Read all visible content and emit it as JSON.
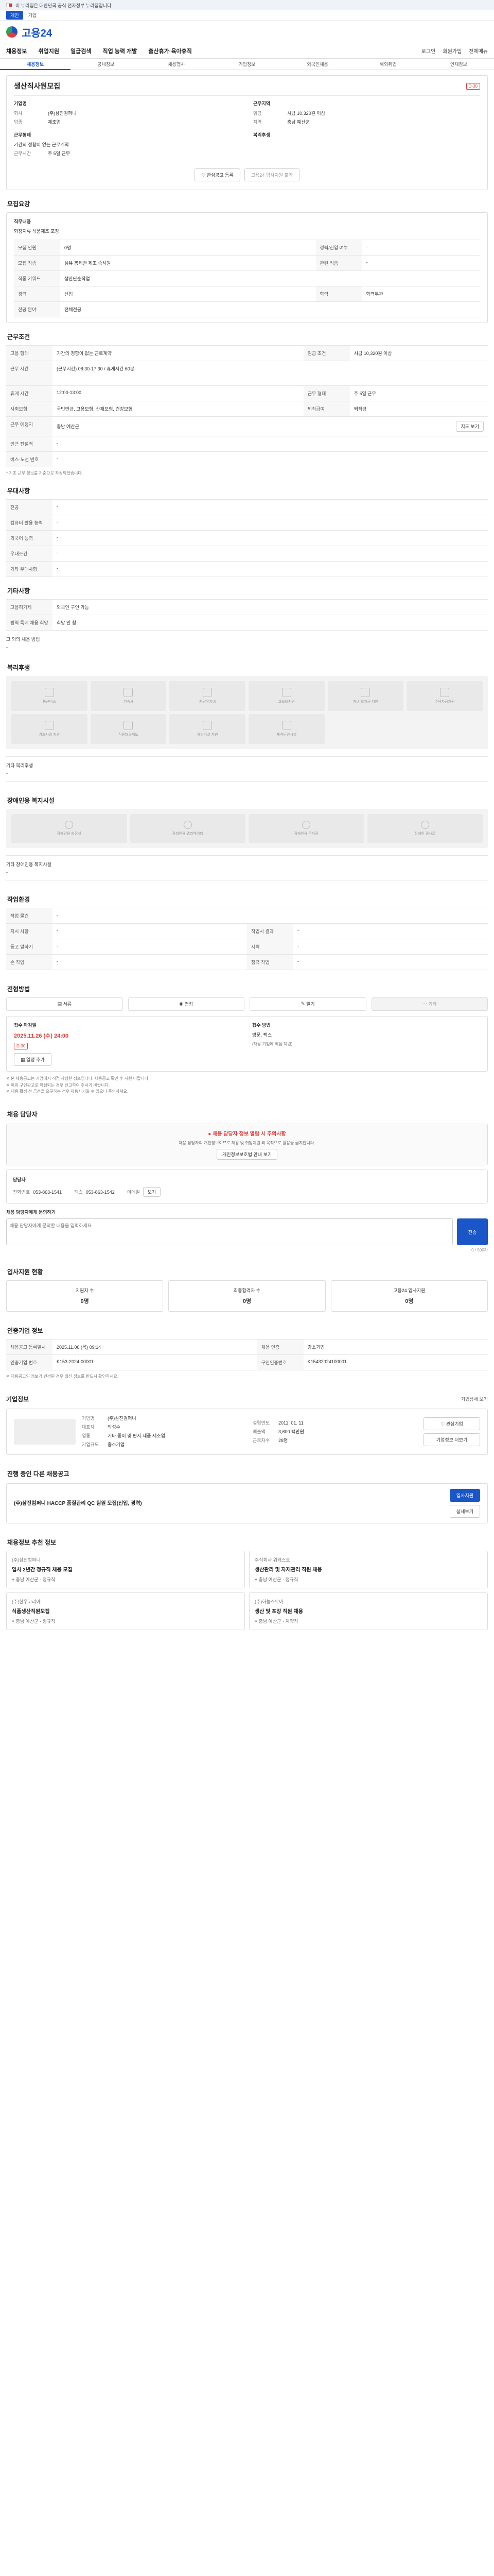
{
  "gov_banner": "이 누리집은 대한민국 공식 전자정부 누리집입니다.",
  "top_util": [
    "개인",
    "기업"
  ],
  "brand": "고용24",
  "gnb": [
    "채용정보",
    "취업지원",
    "일급검색",
    "직업 능력 개발",
    "출산휴가·육아휴직"
  ],
  "gnb_right": [
    "로그인",
    "회원가입",
    "전체메뉴"
  ],
  "subtabs": [
    "채용정보",
    "공채정보",
    "채용행사",
    "기업정보",
    "외국인채용",
    "해외취업",
    "인재정보"
  ],
  "job": {
    "title": "생산직사원모집",
    "badge": "D-30",
    "company": "회사",
    "company_label": "기업명",
    "company_value": "(주)삼진컴퍼니",
    "industry_label": "업종",
    "industry_value": "제조업",
    "workplace_label": "근무지역",
    "salary_label": "임금",
    "salary_value": "시급 10,320원 이상",
    "area_label": "지역",
    "area_value": "충남 예산군 ",
    "period_label": "근무형태",
    "period_value": "기간의 정함이 없는 근로계약",
    "hours_label": "근무시간",
    "hours_value": "주 5일 근무",
    "benefits_label": "복리후생",
    "actions": [
      "관심공고 등록",
      "고용24 입사지원 불가"
    ]
  },
  "recruit_section": {
    "title": "모집요강",
    "duty_label": "직무내용",
    "duty_value": "화장지류 식품제조 포장",
    "rows": [
      [
        "모집 인원",
        "0명",
        "경력/신입 여부",
        "-"
      ],
      [
        "모집 직종",
        "섬유 봉제반 제조 종사원",
        "관련 직종",
        "-"
      ],
      [
        "직종 키워드",
        "생산단순작업",
        "",
        ""
      ],
      [
        "경력",
        "신입",
        "학력",
        "학력무관"
      ],
      [
        "전공 분야",
        "전체전공",
        "",
        ""
      ]
    ]
  },
  "work_section": {
    "title": "근무조건",
    "rows": [
      [
        "고용 형태",
        "기간의 정함이 없는 근로계약",
        "임금 조건",
        "시급 10,320원 이상"
      ],
      [
        "근무 시간",
        "(근무시간) 08:30-17:30 / 휴게시간 60분",
        "",
        ""
      ],
      [
        "휴게 시간",
        "12:00-13:00",
        "근무 형태",
        "주 5일 근무"
      ],
      [
        "사회보험",
        "국민연금, 고용보험, 산재보험, 건강보험",
        "퇴직급여",
        "퇴직금"
      ]
    ],
    "address_label": "근무 예정지",
    "address_value": "충남 예산군 ",
    "map_button": "지도 보기",
    "extra_rows": [
      [
        "인근 전철역",
        "-"
      ],
      [
        "버스·노선 번호",
        "-"
      ]
    ],
    "note": "* 기초 근무 정보를 기준으로 작성되었습니다."
  },
  "pref_section": {
    "title": "우대사항",
    "rows": [
      [
        "전공",
        "-"
      ],
      [
        "컴퓨터 활용 능력",
        "-"
      ],
      [
        "외국어 능력",
        "-"
      ],
      [
        "우대조건",
        "-"
      ],
      [
        "기타 우대사항",
        "-"
      ]
    ]
  },
  "extra_section": {
    "title": "기타사항",
    "rows": [
      [
        "고용허가제",
        "외국인 구인 가능"
      ],
      [
        "병역 특례 채용 희망",
        "희망 안 함"
      ]
    ],
    "other_label": "그 외의 채용 방법",
    "other_value": "-"
  },
  "welfare_section": {
    "title": "복리후생",
    "items": [
      "통근버스",
      "기숙사",
      "차량유지비",
      "교육비지원",
      "자녀 학자금 지원",
      "주택자금지원",
      "경조사비 지원",
      "직원대출제도",
      "휴양시설 지원",
      "체력단련시설"
    ],
    "other_label": "기타 복리후생",
    "other_value": "-"
  },
  "disability_section": {
    "title": "장애인용 복지시설",
    "items": [
      "장애인용 화장실",
      "장애인용 엘리베이터",
      "장애인용 주차장",
      "장애인 경사로"
    ],
    "other_label": "기타 장애인용 복지시설",
    "other_value": "-"
  },
  "env_section": {
    "title": "작업환경",
    "rows": [
      [
        "작업 물건",
        "-",
        "",
        ""
      ],
      [
        "지시 사항",
        "-",
        "작업시 결과",
        "-"
      ],
      [
        "듣고 말하기",
        "-",
        "시력",
        "-"
      ],
      [
        "손 작업",
        "-",
        "청력 작업",
        "-"
      ]
    ]
  },
  "apply_section": {
    "title": "전형방법",
    "methods": [
      "서류",
      "면접",
      "필기",
      "기타"
    ],
    "deadline_label": "접수 마감일",
    "deadline_value": "2025.11.26 (수) 24:00",
    "deadline_badge": "D-30",
    "method_label": "접수 방법",
    "method_value": "방문, 팩스",
    "method_note": "(채용 기업에 직접 지원)",
    "calendar_btn": "일정 추가",
    "notes": [
      "※ 본 채용공고는 기업에서 직접 작성한 정보입니다. 채용공고 확인 후 지원 바랍니다.",
      "※ 허위 구인광고로 의심되는 경우 신고하여 주시기 바랍니다.",
      "※ 채용 확정 전 금전을 요구하는 경우 채용사기일 수 있으니 주의하세요."
    ]
  },
  "contact_section": {
    "title": "채용 담당자",
    "warn_title": "채용 담당자 정보 열람 시 주의사항",
    "warn_text": "채용 담당자의 개인정보이므로 채용 및 취업지원 외 목적으로 활용을 금지합니다.",
    "warn_btn": "개인정보보호법 안내 보기",
    "contact_label": "담당자",
    "tel_label": "전화번호",
    "tel_value": "053-863-1541",
    "fax_label": "팩스",
    "fax_value": "053-863-1542",
    "email_label": "이메일",
    "email_btn": "보기",
    "inquiry_label": "채용 담당자에게 문의하기",
    "inquiry_placeholder": "채용 담당자에게 문의할 내용을 입력하세요.",
    "inquiry_submit": "전송",
    "counter": "0 / 500자"
  },
  "apply_stats": {
    "title": "입사지원 현황",
    "items": [
      [
        "지원자 수",
        "0명"
      ],
      [
        "최종합격자 수",
        "0명"
      ],
      [
        "고용24 입사지원",
        "0명"
      ]
    ]
  },
  "info_section": {
    "title": "인증기업 정보",
    "rows": [
      [
        "채용공고 등록일시",
        "2025.11.06 (목) 09:14",
        "채용 인증",
        "강소기업"
      ],
      [
        "인증기업 번호",
        "K153-2024-00001",
        "구인인증번호",
        "K15432024100001"
      ]
    ],
    "notes": "※ 채용공고의 정보가 변경된 경우 최신 정보를 반드시 확인하세요."
  },
  "company_section": {
    "title": "기업정보",
    "more": "기업상세 보기",
    "name_label": "기업명",
    "name_value": "(주)삼진컴퍼니",
    "ceo_label": "대표자",
    "ceo_value": "박성수",
    "founded_label": "설립연도",
    "founded_value": "2011. 01. 11",
    "industry_label": "업종",
    "industry_value": "기타 종이 및 판지 제품 제조업",
    "sales_label": "매출액",
    "sales_value": "3,600 백만원",
    "size_label": "기업규모",
    "size_value": "중소기업",
    "emp_label": "근로자수",
    "emp_value": "28명",
    "btns": [
      "관심기업",
      "기업정보 더보기"
    ]
  },
  "similar_section": {
    "title": "진행 중인 다른 채용공고",
    "job_title": "(주)삼진컴퍼니 HACCP 품질관리 QC 팀원 모집(신입, 경력)",
    "apply_btn": "입사지원",
    "detail_btn": "상세보기"
  },
  "recommend_section": {
    "title": "채용정보 추천 정보",
    "cards": [
      {
        "company": "(주)삼진컴퍼니",
        "title": "입사 2년간 정규직 채용 모집",
        "loc": "충남 예산군",
        "type": "정규직"
      },
      {
        "company": "주식회사 위캐스트",
        "title": "생산관리 및 자재관리 직원 채용",
        "loc": "충남 예산군",
        "type": "정규직"
      },
      {
        "company": "(주)한우코리아",
        "title": "식품생산직원모집",
        "loc": "충남 예산군",
        "type": "정규직"
      },
      {
        "company": "(주)하늘스토어",
        "title": "생산 및 포장 직원 채용",
        "loc": "충남 예산군",
        "type": "계약직"
      }
    ]
  }
}
